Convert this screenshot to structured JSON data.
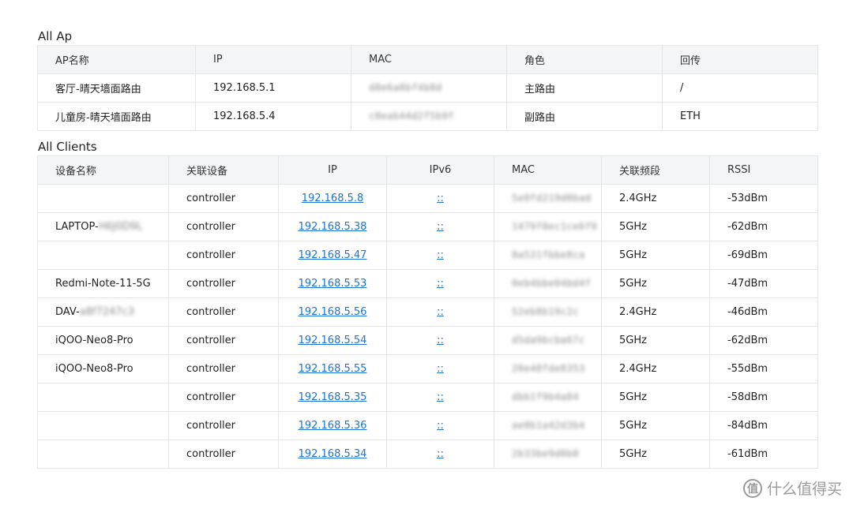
{
  "ap_section": {
    "title": "All Ap",
    "headers": [
      "AP名称",
      "IP",
      "MAC",
      "角色",
      "回传"
    ],
    "rows": [
      {
        "name": "客厅-晴天墙面路由",
        "ip": "192.168.5.1",
        "mac": "d8e6a8bf4b8d",
        "role": "主路由",
        "backhaul": "/"
      },
      {
        "name": "儿童房-晴天墙面路由",
        "ip": "192.168.5.4",
        "mac": "c8eab44d2f5b9f",
        "role": "副路由",
        "backhaul": "ETH"
      }
    ]
  },
  "clients_section": {
    "title": "All Clients",
    "headers": [
      "设备名称",
      "关联设备",
      "IP",
      "IPv6",
      "MAC",
      "关联频段",
      "RSSI"
    ],
    "rows": [
      {
        "name": "",
        "name_hidden": "",
        "assoc": "controller",
        "ip": "192.168.5.8",
        "ipv6": "::",
        "mac": "5e0fd219d0bad",
        "band": "2.4GHz",
        "rssi": "-53dBm"
      },
      {
        "name": "LAPTOP-",
        "name_hidden": "H6J0D9L",
        "assoc": "controller",
        "ip": "192.168.5.38",
        "ipv6": "::",
        "mac": "1479f8ec1ce6f9",
        "band": "5GHz",
        "rssi": "-62dBm"
      },
      {
        "name": "",
        "name_hidden": "",
        "assoc": "controller",
        "ip": "192.168.5.47",
        "ipv6": "::",
        "mac": "8a531fbbe8ca",
        "band": "5GHz",
        "rssi": "-69dBm"
      },
      {
        "name": "Redmi-Note-11-5G",
        "name_hidden": "",
        "assoc": "controller",
        "ip": "192.168.5.53",
        "ipv6": "::",
        "mac": "0eb4bbe04bd4f",
        "band": "5GHz",
        "rssi": "-47dBm"
      },
      {
        "name": "DAV-",
        "name_hidden": "a8f7247c3",
        "assoc": "controller",
        "ip": "192.168.5.56",
        "ipv6": "::",
        "mac": "52eb8b19c2c",
        "band": "2.4GHz",
        "rssi": "-46dBm"
      },
      {
        "name": "iQOO-Neo8-Pro",
        "name_hidden": "",
        "assoc": "controller",
        "ip": "192.168.5.54",
        "ipv6": "::",
        "mac": "d5da9bcba67c",
        "band": "5GHz",
        "rssi": "-62dBm"
      },
      {
        "name": "iQOO-Neo8-Pro",
        "name_hidden": "",
        "assoc": "controller",
        "ip": "192.168.5.55",
        "ipv6": "::",
        "mac": "20e48fde8353",
        "band": "2.4GHz",
        "rssi": "-55dBm"
      },
      {
        "name": "",
        "name_hidden": "",
        "assoc": "controller",
        "ip": "192.168.5.35",
        "ipv6": "::",
        "mac": "dbb1f9b4a84",
        "band": "5GHz",
        "rssi": "-58dBm"
      },
      {
        "name": "",
        "name_hidden": "",
        "assoc": "controller",
        "ip": "192.168.5.36",
        "ipv6": "::",
        "mac": "ae0b1a42d3b4",
        "band": "5GHz",
        "rssi": "-84dBm"
      },
      {
        "name": "",
        "name_hidden": "",
        "assoc": "controller",
        "ip": "192.168.5.34",
        "ipv6": "::",
        "mac": "2b33be9d0b0",
        "band": "5GHz",
        "rssi": "-61dBm"
      }
    ]
  },
  "watermark": {
    "logo_glyph": "值",
    "text": "什么值得买"
  },
  "colors": {
    "link": "#1a73d9",
    "header_bg": "#f4f5f7",
    "border": "#e4e6ea"
  }
}
